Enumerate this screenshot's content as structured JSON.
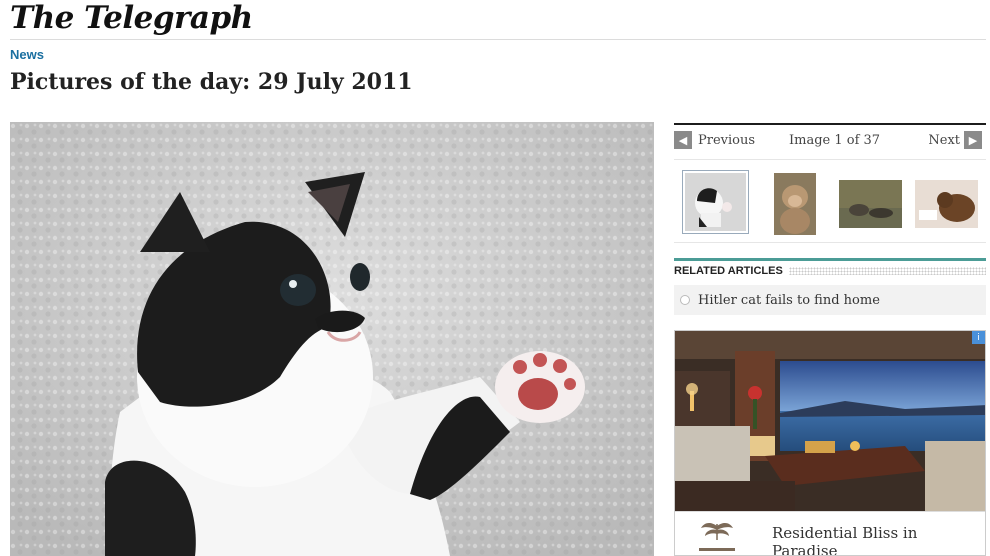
{
  "masthead": {
    "logo_text": "The Telegraph"
  },
  "article": {
    "section": "News",
    "headline": "Pictures of the day: 29 July 2011"
  },
  "gallery": {
    "prev_label": "Previous",
    "next_label": "Next",
    "counter": "Image 1 of 37",
    "prev_icon": "chevron-left-icon",
    "next_icon": "chevron-right-icon"
  },
  "related": {
    "title": "RELATED ARTICLES",
    "items": [
      {
        "label": "Hitler cat fails to find home"
      }
    ]
  },
  "ad": {
    "tagline": "Residential Bliss in Paradise",
    "adchoices_icon": "ad-info-icon"
  },
  "colors": {
    "section_link": "#1a6fa0",
    "related_accent": "#4b9c96",
    "nav_arrow": "#8a8a8a"
  }
}
